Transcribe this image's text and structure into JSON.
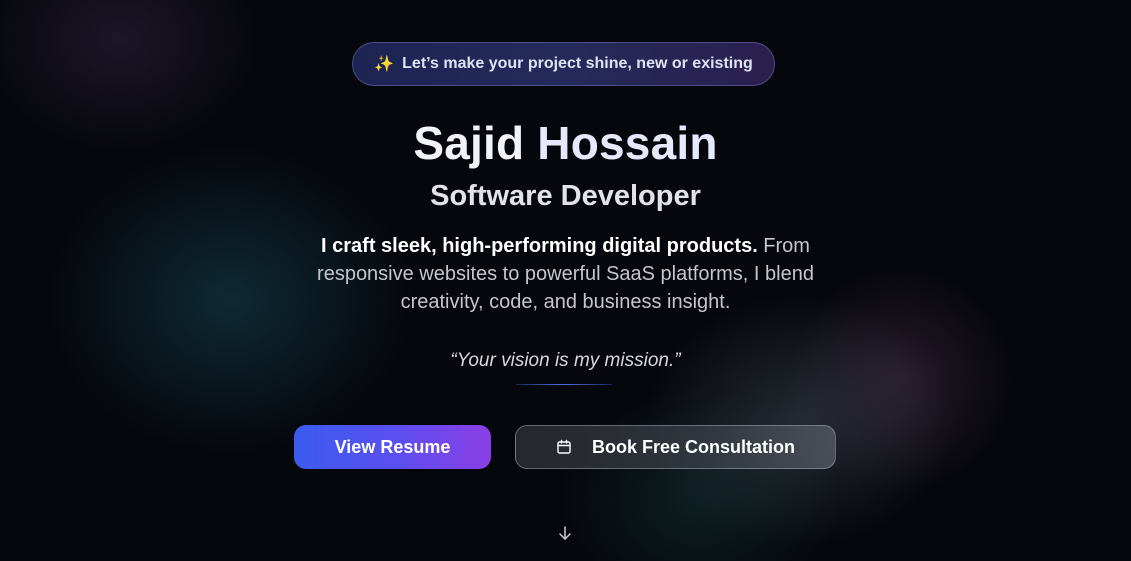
{
  "badge": {
    "icon": "sparkles-icon",
    "text": "Let’s make your project shine, new or existing"
  },
  "hero": {
    "first_name": "Sajid",
    "last_name": "Hossain",
    "role": "Software Developer",
    "description_bold": "I craft sleek, high-performing digital products.",
    "description_rest": " From responsive websites to powerful SaaS platforms, I blend creativity, code, and business insight.",
    "quote": "“Your vision is my mission.”"
  },
  "actions": {
    "resume_label": "View Resume",
    "consult_label": "Book Free Consultation",
    "consult_icon": "calendar-icon"
  },
  "scroll": {
    "icon": "arrow-down-icon"
  },
  "colors": {
    "background": "#06070c",
    "accent_blue": "#3b5cf0",
    "accent_purple": "#8a3fe6",
    "badge_bg": "#1c2453"
  }
}
